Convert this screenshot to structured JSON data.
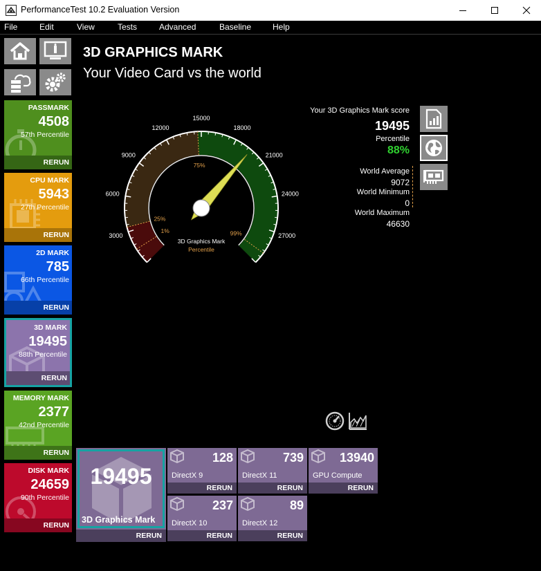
{
  "window": {
    "title": "PerformanceTest 10.2 Evaluation Version"
  },
  "menu": [
    "File",
    "Edit",
    "View",
    "Tests",
    "Advanced",
    "Baseline",
    "Help"
  ],
  "left_icons": [
    "home-icon",
    "monitor-icon",
    "cloud-server-icon",
    "gears-icon"
  ],
  "tiles": [
    {
      "title": "PASSMARK",
      "score": "4508",
      "percentile": "57th Percentile",
      "rerun": "RERUN",
      "color": "#4f8f1e",
      "rerun_color": "#356615"
    },
    {
      "title": "CPU MARK",
      "score": "5943",
      "percentile": "27th Percentile",
      "rerun": "RERUN",
      "color": "#e49c0e",
      "rerun_color": "#a97409"
    },
    {
      "title": "2D MARK",
      "score": "785",
      "percentile": "66th Percentile",
      "rerun": "RERUN",
      "color": "#0b57e4",
      "rerun_color": "#0740a8"
    },
    {
      "title": "3D MARK",
      "score": "19495",
      "percentile": "88th Percentile",
      "rerun": "RERUN",
      "color": "#8c74ac",
      "rerun_color": "#5d4d72"
    },
    {
      "title": "MEMORY MARK",
      "score": "2377",
      "percentile": "42nd Percentile",
      "rerun": "RERUN",
      "color": "#5aa423",
      "rerun_color": "#3e7418"
    },
    {
      "title": "DISK MARK",
      "score": "24659",
      "percentile": "90th Percentile",
      "rerun": "RERUN",
      "color": "#bd0a2c",
      "rerun_color": "#870720"
    }
  ],
  "header": {
    "title": "3D GRAPHICS MARK",
    "subtitle": "Your Video Card vs the world"
  },
  "gauge": {
    "min": 0,
    "max": 30000,
    "ticks": [
      "0",
      "3000",
      "6000",
      "9000",
      "12000",
      "15000",
      "18000",
      "21000",
      "24000",
      "27000",
      "30000"
    ],
    "value": 19495,
    "percentile_markers": [
      {
        "label": "1%",
        "value": 1400
      },
      {
        "label": "25%",
        "value": 3400
      },
      {
        "label": "75%",
        "value": 14700
      },
      {
        "label": "99%",
        "value": 29000
      }
    ],
    "center_label": "3D Graphics Mark",
    "center_sublabel": "Percentile",
    "colors": {
      "low": "#4a0b0b",
      "mid": "#3a2812",
      "high": "#0e4a0e",
      "accent": "#e2a04a",
      "needle": "#dede55"
    }
  },
  "score_panel": {
    "score_label": "Your 3D Graphics Mark score",
    "score": "19495",
    "percentile_label": "Percentile",
    "percentile": "88%",
    "percentile_color": "#30d130",
    "world_average_label": "World Average",
    "world_average": "9072",
    "world_minimum_label": "World Minimum",
    "world_minimum": "0",
    "world_maximum_label": "World Maximum",
    "world_maximum": "46630"
  },
  "side_buttons": [
    "report-icon",
    "globe-icon",
    "graphics-card-icon"
  ],
  "bottom_icons": [
    "gauge-icon",
    "chart-icon"
  ],
  "main_test": {
    "score": "19495",
    "label": "3D Graphics Mark",
    "rerun": "RERUN"
  },
  "sub_tests": [
    {
      "score": "128",
      "label": "DirectX 9",
      "rerun": "RERUN"
    },
    {
      "score": "739",
      "label": "DirectX 11",
      "rerun": "RERUN"
    },
    {
      "score": "13940",
      "label": "GPU Compute",
      "rerun": "RERUN"
    },
    {
      "score": "237",
      "label": "DirectX 10",
      "rerun": "RERUN"
    },
    {
      "score": "89",
      "label": "DirectX 12",
      "rerun": "RERUN"
    }
  ]
}
